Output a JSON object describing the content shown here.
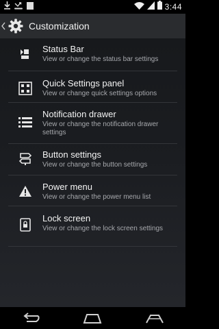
{
  "status_bar": {
    "time": "3:44",
    "left_icons": [
      "download-icon",
      "missed-call-icon",
      "image-icon"
    ],
    "right_icons": [
      "wifi-icon",
      "signal-icon",
      "battery-icon"
    ]
  },
  "action_bar": {
    "title": "Customization",
    "icon": "gear-icon"
  },
  "items": [
    {
      "title": "Status Bar",
      "subtitle": "View or change the status bar settings",
      "icon": "status-bar-icon"
    },
    {
      "title": "Quick Settings panel",
      "subtitle": "View or change quick settings options",
      "icon": "quick-settings-icon"
    },
    {
      "title": "Notification drawer",
      "subtitle": "View or change the notification drawer settings",
      "icon": "notification-drawer-icon"
    },
    {
      "title": "Button settings",
      "subtitle": "View or change the button settings",
      "icon": "button-settings-icon"
    },
    {
      "title": "Power menu",
      "subtitle": "View or change the power menu list",
      "icon": "power-menu-icon"
    },
    {
      "title": "Lock screen",
      "subtitle": "View or change the lock screen settings",
      "icon": "lock-screen-icon"
    }
  ],
  "nav_bar": {
    "buttons": [
      "back-icon",
      "home-icon",
      "recents-icon"
    ]
  }
}
